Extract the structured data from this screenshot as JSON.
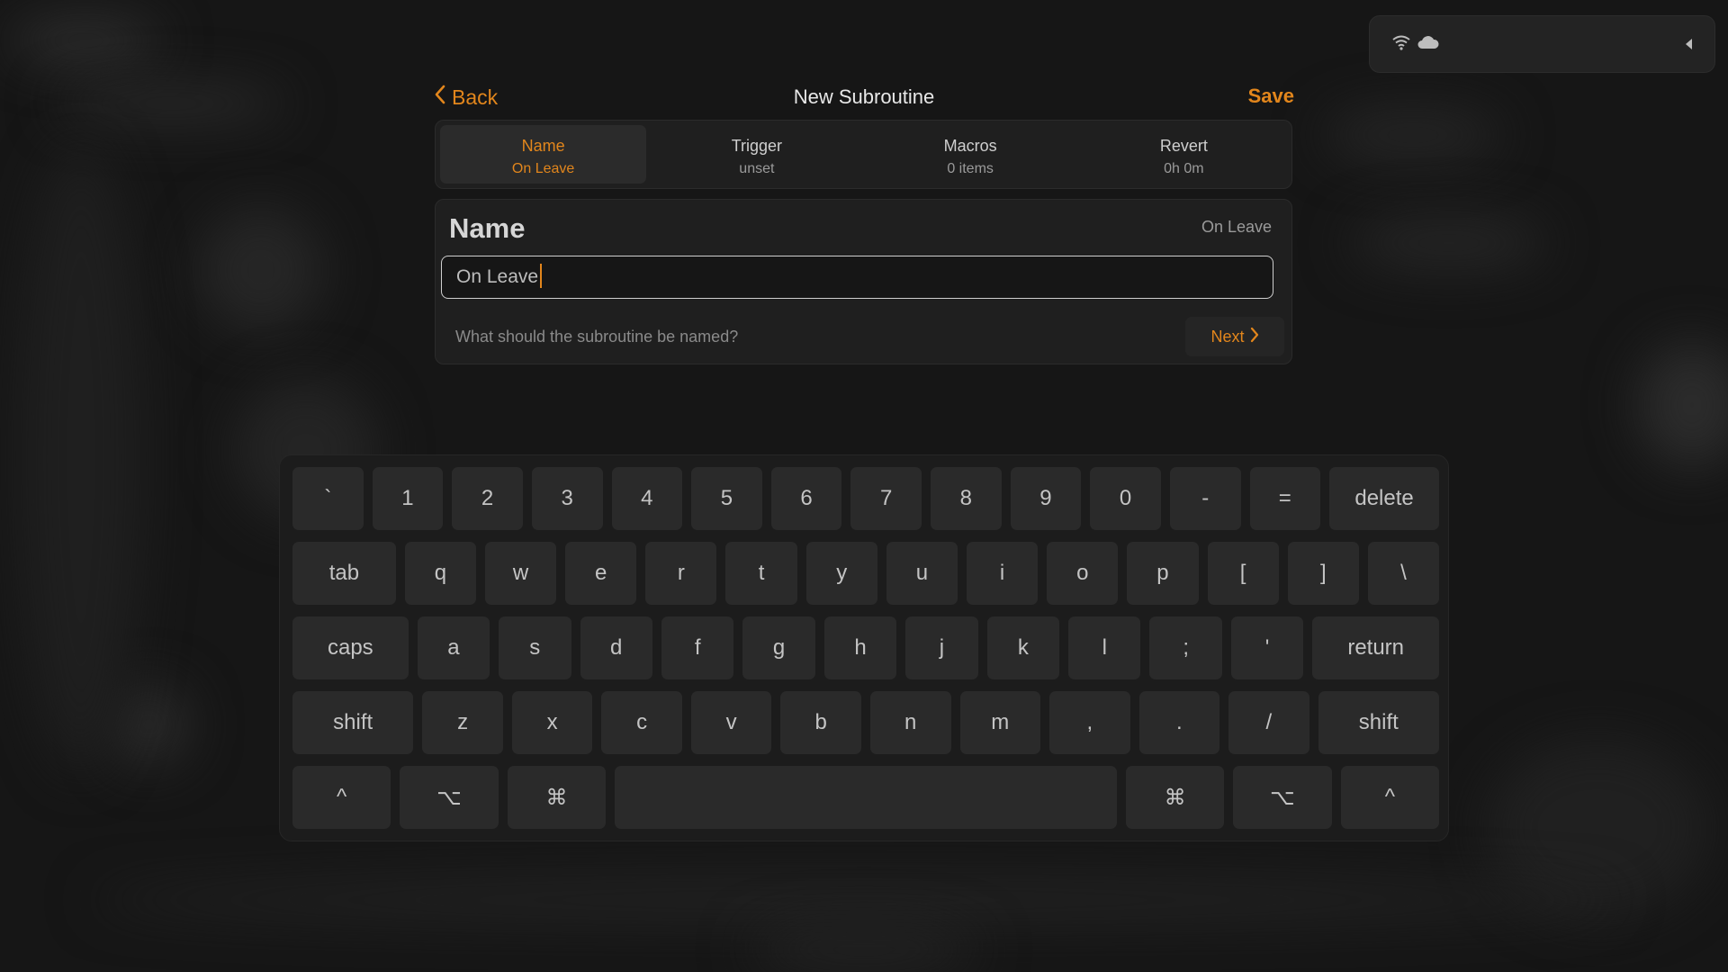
{
  "header": {
    "back_label": "Back",
    "title": "New Subroutine",
    "save_label": "Save"
  },
  "tabs": [
    {
      "label": "Name",
      "value": "On Leave",
      "active": true
    },
    {
      "label": "Trigger",
      "value": "unset",
      "active": false
    },
    {
      "label": "Macros",
      "value": "0 items",
      "active": false
    },
    {
      "label": "Revert",
      "value": "0h 0m",
      "active": false
    }
  ],
  "card": {
    "title": "Name",
    "value": "On Leave",
    "input_value": "On Leave",
    "hint": "What should the subroutine be named?",
    "next_label": "Next"
  },
  "keyboard": {
    "row1": [
      "`",
      "1",
      "2",
      "3",
      "4",
      "5",
      "6",
      "7",
      "8",
      "9",
      "0",
      "-",
      "=",
      "delete"
    ],
    "row2": [
      "tab",
      "q",
      "w",
      "e",
      "r",
      "t",
      "y",
      "u",
      "i",
      "o",
      "p",
      "[",
      "]",
      "\\"
    ],
    "row3": [
      "caps",
      "a",
      "s",
      "d",
      "f",
      "g",
      "h",
      "j",
      "k",
      "l",
      ";",
      "'",
      "return"
    ],
    "row4": [
      "shift",
      "z",
      "x",
      "c",
      "v",
      "b",
      "n",
      "m",
      ",",
      ".",
      "/",
      "shift"
    ],
    "row5": [
      "^",
      "⌥",
      "⌘",
      "",
      "⌘",
      "⌥",
      "^"
    ]
  },
  "colors": {
    "accent": "#e2861c",
    "background": "#161616",
    "panel": "#1f1f1f",
    "key": "#2a2a2a"
  },
  "icons": {
    "status": [
      "wifi-icon",
      "cloud-icon",
      "collapse-triangle-icon"
    ],
    "back": "chevron-left-icon",
    "next": "chevron-right-icon"
  }
}
